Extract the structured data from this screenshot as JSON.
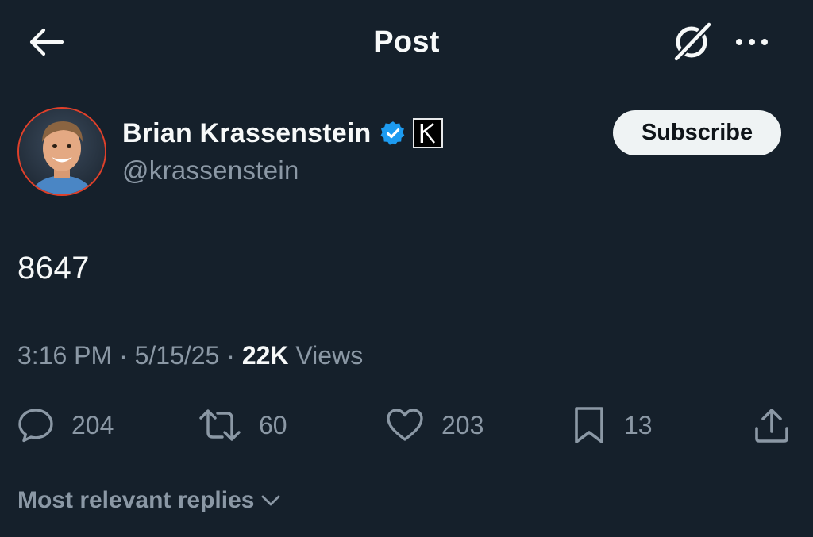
{
  "header": {
    "title": "Post",
    "back_icon": "arrow-left-icon",
    "grok_icon": "grok-icon",
    "more_icon": "more-horizontal-icon"
  },
  "author": {
    "name": "Brian Krassenstein",
    "handle": "@krassenstein",
    "verified": true,
    "verified_color": "#1d9bf0",
    "affiliation_badge": "K",
    "avatar_ring_color": "#e0402a"
  },
  "subscribe_label": "Subscribe",
  "post": {
    "text": "8647"
  },
  "meta": {
    "time": "3:16 PM",
    "separator": "·",
    "date": "5/15/25",
    "views_count": "22K",
    "views_label": "Views"
  },
  "actions": {
    "replies": "204",
    "reposts": "60",
    "likes": "203",
    "bookmarks": "13"
  },
  "replies_sort": {
    "label": "Most relevant replies"
  },
  "colors": {
    "background": "#15202b",
    "primary_text": "#f7f9f9",
    "secondary_text": "#8b98a5",
    "button_bg": "#eff3f4"
  }
}
